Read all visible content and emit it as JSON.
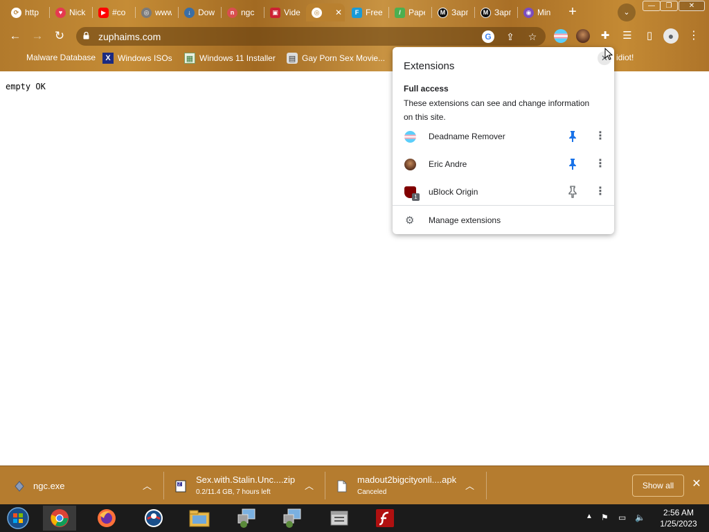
{
  "browser": {
    "tabs": [
      {
        "title": "http",
        "favicon": "link-icon",
        "color": "#ffffff"
      },
      {
        "title": "Nick",
        "favicon": "heart-icon",
        "color": "#e53950"
      },
      {
        "title": "#co",
        "favicon": "youtube-icon",
        "color": "#ff0000"
      },
      {
        "title": "www",
        "favicon": "globe-icon",
        "color": "#7a7a7a"
      },
      {
        "title": "Dow",
        "favicon": "download-site-icon",
        "color": "#3a6ea5"
      },
      {
        "title": "ngc",
        "favicon": "ngc-icon",
        "color": "#d94f4f"
      },
      {
        "title": "Vide",
        "favicon": "tv-icon",
        "color": "#cc2233"
      },
      {
        "title": "",
        "favicon": "globe-icon",
        "color": "#ffffff",
        "active": true
      },
      {
        "title": "Free",
        "favicon": "chat-icon",
        "color": "#1a9ad6"
      },
      {
        "title": "Pape",
        "favicon": "paper-icon",
        "color": "#4caf50"
      },
      {
        "title": "Зарп",
        "favicon": "m-icon",
        "color": "#111111"
      },
      {
        "title": "Зарп",
        "favicon": "m-icon",
        "color": "#111111"
      },
      {
        "title": "Min",
        "favicon": "eye-icon",
        "color": "#7b4dbd"
      }
    ],
    "url": "zuphaims.com",
    "bookmarks": [
      {
        "label": "Malware Database",
        "icon": ""
      },
      {
        "label": "Windows ISOs",
        "icon": "x-box-icon"
      },
      {
        "label": "Windows 11 Installer",
        "icon": "image-icon"
      },
      {
        "label": "Gay Porn Sex Movie...",
        "icon": "folder-icon"
      },
      {
        "label": "idiot!",
        "icon": ""
      }
    ]
  },
  "page": {
    "content": "empty OK"
  },
  "extensions_popup": {
    "title": "Extensions",
    "section": "Full access",
    "description": "These extensions can see and change information on this site.",
    "items": [
      {
        "name": "Deadname Remover",
        "pinned": true
      },
      {
        "name": "Eric Andre",
        "pinned": true
      },
      {
        "name": "uBlock Origin",
        "pinned": false
      }
    ],
    "manage_label": "Manage extensions"
  },
  "downloads": {
    "items": [
      {
        "name": "ngc.exe",
        "status": ""
      },
      {
        "name": "Sex.with.Stalin.Unc....zip",
        "status": "0.2/11.4 GB, 7 hours left"
      },
      {
        "name": "madout2bigcityonli....apk",
        "status": "Canceled"
      }
    ],
    "show_all": "Show all"
  },
  "taskbar": {
    "apps": [
      "start-orb",
      "chrome",
      "firefox",
      "ie-outlook",
      "file-explorer",
      "network-pc",
      "network-pc-2",
      "archive",
      "flash"
    ],
    "time": "2:56 AM",
    "date": "1/25/2023"
  },
  "colors": {
    "theme_gold": "#b57c2f",
    "pin_blue": "#1a73e8",
    "taskbar": "#1b1b1b"
  }
}
